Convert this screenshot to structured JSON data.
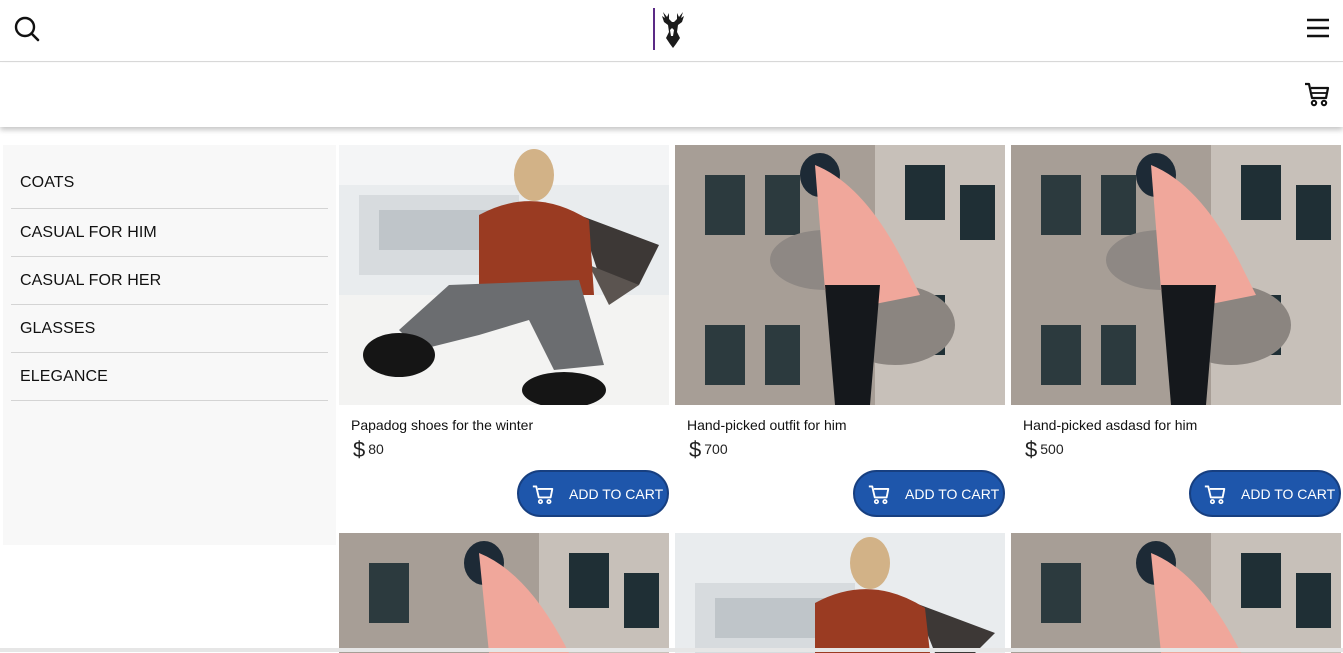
{
  "header": {
    "search_icon": "search-icon",
    "logo_icon": "deer-logo-icon",
    "menu_icon": "hamburger-menu-icon",
    "cart_icon": "shopping-cart-icon"
  },
  "sidebar": {
    "categories": [
      {
        "label": "COATS"
      },
      {
        "label": "CASUAL FOR HIM"
      },
      {
        "label": "CASUAL FOR HER"
      },
      {
        "label": "GLASSES"
      },
      {
        "label": "ELEGANCE"
      }
    ]
  },
  "products": [
    {
      "title": "Papadog shoes for the winter",
      "currency": "$",
      "price": "80",
      "button": "ADD TO CART",
      "image": "woman-sitting-red-sweater"
    },
    {
      "title": "Hand-picked outfit for him",
      "currency": "$",
      "price": "700",
      "button": "ADD TO CART",
      "image": "man-pink-hoodie-building"
    },
    {
      "title": "Hand-picked asdasd for him",
      "currency": "$",
      "price": "500",
      "button": "ADD TO CART",
      "image": "man-pink-hoodie-building"
    }
  ],
  "products_row2": [
    {
      "image": "man-pink-hoodie-building"
    },
    {
      "image": "woman-sitting-red-sweater"
    },
    {
      "image": "man-pink-hoodie-building"
    }
  ],
  "colors": {
    "button": "#1e56ab",
    "logo_bar": "#5b2a86",
    "sidebar_bg": "#f8f8f8"
  }
}
